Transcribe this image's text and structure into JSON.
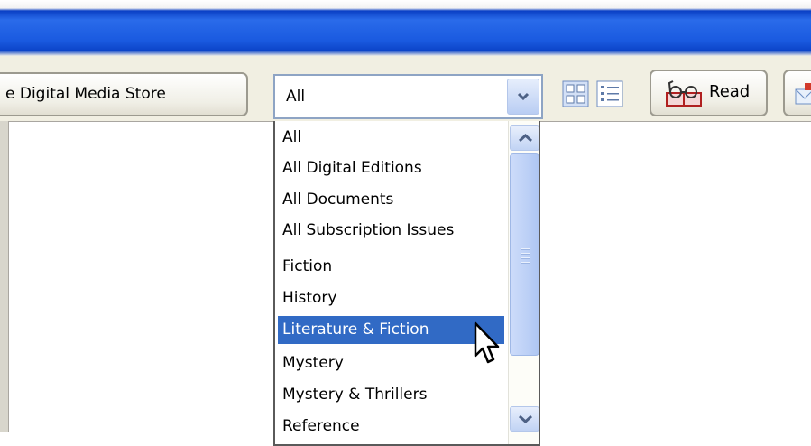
{
  "toolbar": {
    "store_button_label": "e Digital Media Store",
    "filter_combo": {
      "value": "All",
      "options": [
        "All",
        "All Digital Editions",
        "All Documents",
        "All Subscription Issues",
        "Fiction",
        "History",
        "Literature & Fiction",
        "Mystery",
        "Mystery & Thrillers",
        "Reference"
      ],
      "highlighted_option": "Literature & Fiction"
    },
    "read_button_label": "Read"
  },
  "icons": {
    "thumbnail_view": "thumbnail-view-icon",
    "list_view": "list-view-icon",
    "read": "glasses-book-icon",
    "extra": "email-icon",
    "cursor": "mouse-pointer-icon"
  },
  "colors": {
    "title_bar": "#1a5ae0",
    "selection": "#316ac5",
    "toolbar_bg": "#f1efe2"
  }
}
